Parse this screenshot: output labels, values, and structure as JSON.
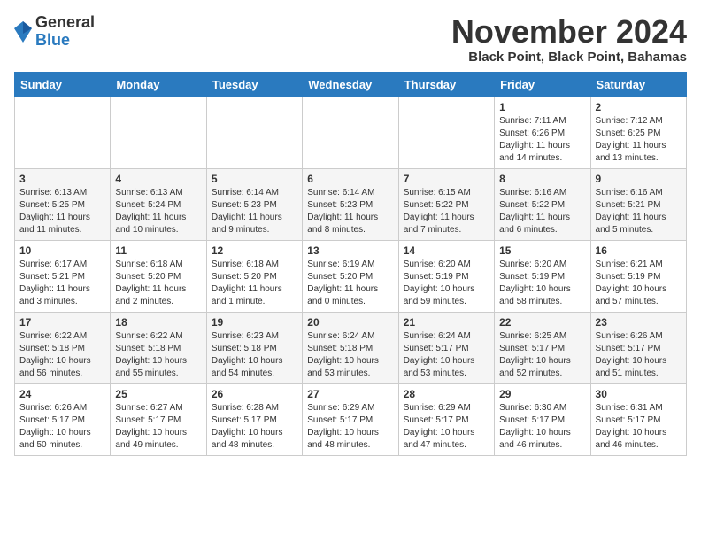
{
  "logo": {
    "general": "General",
    "blue": "Blue"
  },
  "header": {
    "title": "November 2024",
    "subtitle": "Black Point, Black Point, Bahamas"
  },
  "weekdays": [
    "Sunday",
    "Monday",
    "Tuesday",
    "Wednesday",
    "Thursday",
    "Friday",
    "Saturday"
  ],
  "weeks": [
    [
      {
        "day": "",
        "info": ""
      },
      {
        "day": "",
        "info": ""
      },
      {
        "day": "",
        "info": ""
      },
      {
        "day": "",
        "info": ""
      },
      {
        "day": "",
        "info": ""
      },
      {
        "day": "1",
        "info": "Sunrise: 7:11 AM\nSunset: 6:26 PM\nDaylight: 11 hours and 14 minutes."
      },
      {
        "day": "2",
        "info": "Sunrise: 7:12 AM\nSunset: 6:25 PM\nDaylight: 11 hours and 13 minutes."
      }
    ],
    [
      {
        "day": "3",
        "info": "Sunrise: 6:13 AM\nSunset: 5:25 PM\nDaylight: 11 hours and 11 minutes."
      },
      {
        "day": "4",
        "info": "Sunrise: 6:13 AM\nSunset: 5:24 PM\nDaylight: 11 hours and 10 minutes."
      },
      {
        "day": "5",
        "info": "Sunrise: 6:14 AM\nSunset: 5:23 PM\nDaylight: 11 hours and 9 minutes."
      },
      {
        "day": "6",
        "info": "Sunrise: 6:14 AM\nSunset: 5:23 PM\nDaylight: 11 hours and 8 minutes."
      },
      {
        "day": "7",
        "info": "Sunrise: 6:15 AM\nSunset: 5:22 PM\nDaylight: 11 hours and 7 minutes."
      },
      {
        "day": "8",
        "info": "Sunrise: 6:16 AM\nSunset: 5:22 PM\nDaylight: 11 hours and 6 minutes."
      },
      {
        "day": "9",
        "info": "Sunrise: 6:16 AM\nSunset: 5:21 PM\nDaylight: 11 hours and 5 minutes."
      }
    ],
    [
      {
        "day": "10",
        "info": "Sunrise: 6:17 AM\nSunset: 5:21 PM\nDaylight: 11 hours and 3 minutes."
      },
      {
        "day": "11",
        "info": "Sunrise: 6:18 AM\nSunset: 5:20 PM\nDaylight: 11 hours and 2 minutes."
      },
      {
        "day": "12",
        "info": "Sunrise: 6:18 AM\nSunset: 5:20 PM\nDaylight: 11 hours and 1 minute."
      },
      {
        "day": "13",
        "info": "Sunrise: 6:19 AM\nSunset: 5:20 PM\nDaylight: 11 hours and 0 minutes."
      },
      {
        "day": "14",
        "info": "Sunrise: 6:20 AM\nSunset: 5:19 PM\nDaylight: 10 hours and 59 minutes."
      },
      {
        "day": "15",
        "info": "Sunrise: 6:20 AM\nSunset: 5:19 PM\nDaylight: 10 hours and 58 minutes."
      },
      {
        "day": "16",
        "info": "Sunrise: 6:21 AM\nSunset: 5:19 PM\nDaylight: 10 hours and 57 minutes."
      }
    ],
    [
      {
        "day": "17",
        "info": "Sunrise: 6:22 AM\nSunset: 5:18 PM\nDaylight: 10 hours and 56 minutes."
      },
      {
        "day": "18",
        "info": "Sunrise: 6:22 AM\nSunset: 5:18 PM\nDaylight: 10 hours and 55 minutes."
      },
      {
        "day": "19",
        "info": "Sunrise: 6:23 AM\nSunset: 5:18 PM\nDaylight: 10 hours and 54 minutes."
      },
      {
        "day": "20",
        "info": "Sunrise: 6:24 AM\nSunset: 5:18 PM\nDaylight: 10 hours and 53 minutes."
      },
      {
        "day": "21",
        "info": "Sunrise: 6:24 AM\nSunset: 5:17 PM\nDaylight: 10 hours and 53 minutes."
      },
      {
        "day": "22",
        "info": "Sunrise: 6:25 AM\nSunset: 5:17 PM\nDaylight: 10 hours and 52 minutes."
      },
      {
        "day": "23",
        "info": "Sunrise: 6:26 AM\nSunset: 5:17 PM\nDaylight: 10 hours and 51 minutes."
      }
    ],
    [
      {
        "day": "24",
        "info": "Sunrise: 6:26 AM\nSunset: 5:17 PM\nDaylight: 10 hours and 50 minutes."
      },
      {
        "day": "25",
        "info": "Sunrise: 6:27 AM\nSunset: 5:17 PM\nDaylight: 10 hours and 49 minutes."
      },
      {
        "day": "26",
        "info": "Sunrise: 6:28 AM\nSunset: 5:17 PM\nDaylight: 10 hours and 48 minutes."
      },
      {
        "day": "27",
        "info": "Sunrise: 6:29 AM\nSunset: 5:17 PM\nDaylight: 10 hours and 48 minutes."
      },
      {
        "day": "28",
        "info": "Sunrise: 6:29 AM\nSunset: 5:17 PM\nDaylight: 10 hours and 47 minutes."
      },
      {
        "day": "29",
        "info": "Sunrise: 6:30 AM\nSunset: 5:17 PM\nDaylight: 10 hours and 46 minutes."
      },
      {
        "day": "30",
        "info": "Sunrise: 6:31 AM\nSunset: 5:17 PM\nDaylight: 10 hours and 46 minutes."
      }
    ]
  ]
}
